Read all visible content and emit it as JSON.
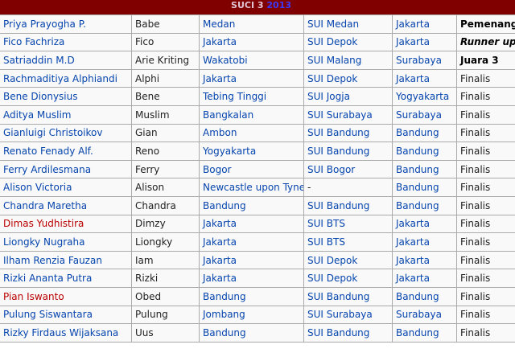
{
  "header": {
    "title": "SUCI 3",
    "year": "2013"
  },
  "rows": [
    {
      "name": "Priya Prayogha P.",
      "name_red": false,
      "nick": "Babe",
      "from": "Medan",
      "audition": "SUI Medan",
      "city": "Jakarta",
      "result": "Pemenang",
      "result_style": "bold"
    },
    {
      "name": "Fico Fachriza",
      "name_red": false,
      "nick": "Fico",
      "from": "Jakarta",
      "audition": "SUI Depok",
      "city": "Jakarta",
      "result": "Runner up",
      "result_style": "boldit"
    },
    {
      "name": "Satriaddin M.D",
      "name_red": false,
      "nick": "Arie Kriting",
      "from": "Wakatobi",
      "audition": "SUI Malang",
      "city": "Surabaya",
      "result": "Juara 3",
      "result_style": "bold"
    },
    {
      "name": "Rachmaditiya Alphiandi",
      "name_red": false,
      "nick": "Alphi",
      "from": "Jakarta",
      "audition": "SUI Depok",
      "city": "Jakarta",
      "result": "Finalis",
      "result_style": "plain"
    },
    {
      "name": "Bene Dionysius",
      "name_red": false,
      "nick": "Bene",
      "from": "Tebing Tinggi",
      "audition": "SUI Jogja",
      "city": "Yogyakarta",
      "result": "Finalis",
      "result_style": "plain"
    },
    {
      "name": "Aditya Muslim",
      "name_red": false,
      "nick": "Muslim",
      "from": "Bangkalan",
      "audition": "SUI Surabaya",
      "city": "Surabaya",
      "result": "Finalis",
      "result_style": "plain"
    },
    {
      "name": "Gianluigi Christoikov",
      "name_red": false,
      "nick": "Gian",
      "from": "Ambon",
      "audition": "SUI Bandung",
      "city": "Bandung",
      "result": "Finalis",
      "result_style": "plain"
    },
    {
      "name": "Renato Fenady Alf.",
      "name_red": false,
      "nick": "Reno",
      "from": "Yogyakarta",
      "audition": "SUI Bandung",
      "city": "Bandung",
      "result": "Finalis",
      "result_style": "plain"
    },
    {
      "name": "Ferry Ardilesmana",
      "name_red": false,
      "nick": "Ferry",
      "from": "Bogor",
      "audition": "SUI Bogor",
      "city": "Bandung",
      "result": "Finalis",
      "result_style": "plain"
    },
    {
      "name": "Alison Victoria",
      "name_red": false,
      "nick": "Alison",
      "from": "Newcastle upon Tyne",
      "audition": "-",
      "city": "Bandung",
      "result": "Finalis",
      "result_style": "plain"
    },
    {
      "name": "Chandra Maretha",
      "name_red": false,
      "nick": "Chandra",
      "from": "Bandung",
      "audition": "SUI Bandung",
      "city": "Bandung",
      "result": "Finalis",
      "result_style": "plain"
    },
    {
      "name": "Dimas Yudhistira",
      "name_red": true,
      "nick": "Dimzy",
      "from": "Jakarta",
      "audition": "SUI BTS",
      "city": "Jakarta",
      "result": "Finalis",
      "result_style": "plain"
    },
    {
      "name": "Liongky Nugraha",
      "name_red": false,
      "nick": "Liongky",
      "from": "Jakarta",
      "audition": "SUI BTS",
      "city": "Jakarta",
      "result": "Finalis",
      "result_style": "plain"
    },
    {
      "name": "Ilham Renzia Fauzan",
      "name_red": false,
      "nick": "Iam",
      "from": "Jakarta",
      "audition": "SUI Depok",
      "city": "Jakarta",
      "result": "Finalis",
      "result_style": "plain"
    },
    {
      "name": "Rizki Ananta Putra",
      "name_red": false,
      "nick": "Rizki",
      "from": "Jakarta",
      "audition": "SUI Depok",
      "city": "Jakarta",
      "result": "Finalis",
      "result_style": "plain"
    },
    {
      "name": "Pian Iswanto",
      "name_red": true,
      "nick": "Obed",
      "from": "Bandung",
      "audition": "SUI Bandung",
      "city": "Bandung",
      "result": "Finalis",
      "result_style": "plain"
    },
    {
      "name": "Pulung Siswantara",
      "name_red": false,
      "nick": "Pulung",
      "from": "Jombang",
      "audition": "SUI Surabaya",
      "city": "Surabaya",
      "result": "Finalis",
      "result_style": "plain"
    },
    {
      "name": "Rizky Firdaus Wijaksana",
      "name_red": false,
      "nick": "Uus",
      "from": "Bandung",
      "audition": "SUI Bandung",
      "city": "Bandung",
      "result": "Finalis",
      "result_style": "plain"
    }
  ]
}
